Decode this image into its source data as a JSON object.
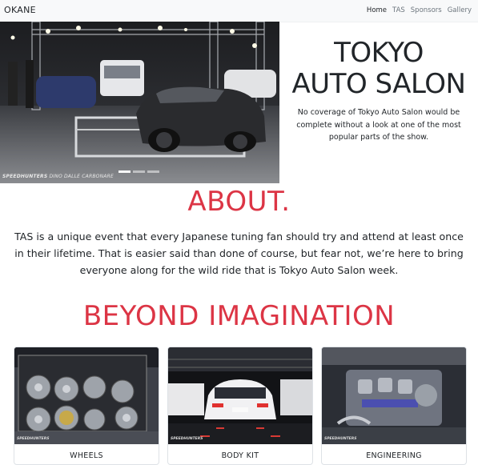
{
  "navbar": {
    "brand": "OKANE",
    "links": [
      {
        "label": "Home",
        "active": true
      },
      {
        "label": "TAS",
        "active": false
      },
      {
        "label": "Sponsors",
        "active": false
      },
      {
        "label": "Gallery",
        "active": false
      }
    ]
  },
  "hero": {
    "title_line1": "TOKYO",
    "title_line2": "AUTO SALON",
    "subtitle": "No coverage of Tokyo Auto Salon would be complete without a look at one of the most popular parts of the show.",
    "watermark_brand": "SPEEDHUNTERS",
    "watermark_credit": "DINO DALLE CARBONARE",
    "carousel_slides": 3,
    "carousel_active": 0
  },
  "about": {
    "heading": "ABOUT.",
    "body": "TAS is a unique event that every Japanese tuning fan should try and attend at least once in their lifetime. That is easier said than done of course, but fear not, we’re here to bring everyone along for the wild ride that is Tokyo Auto Salon week."
  },
  "beyond": {
    "heading": "BEYOND IMAGINATION"
  },
  "cards": [
    {
      "title": "WHEELS"
    },
    {
      "title": "BODY KIT"
    },
    {
      "title": "ENGINEERING"
    }
  ],
  "colors": {
    "accent": "#dc3545",
    "navbar_bg": "#f8f9fa",
    "text": "#212529"
  }
}
